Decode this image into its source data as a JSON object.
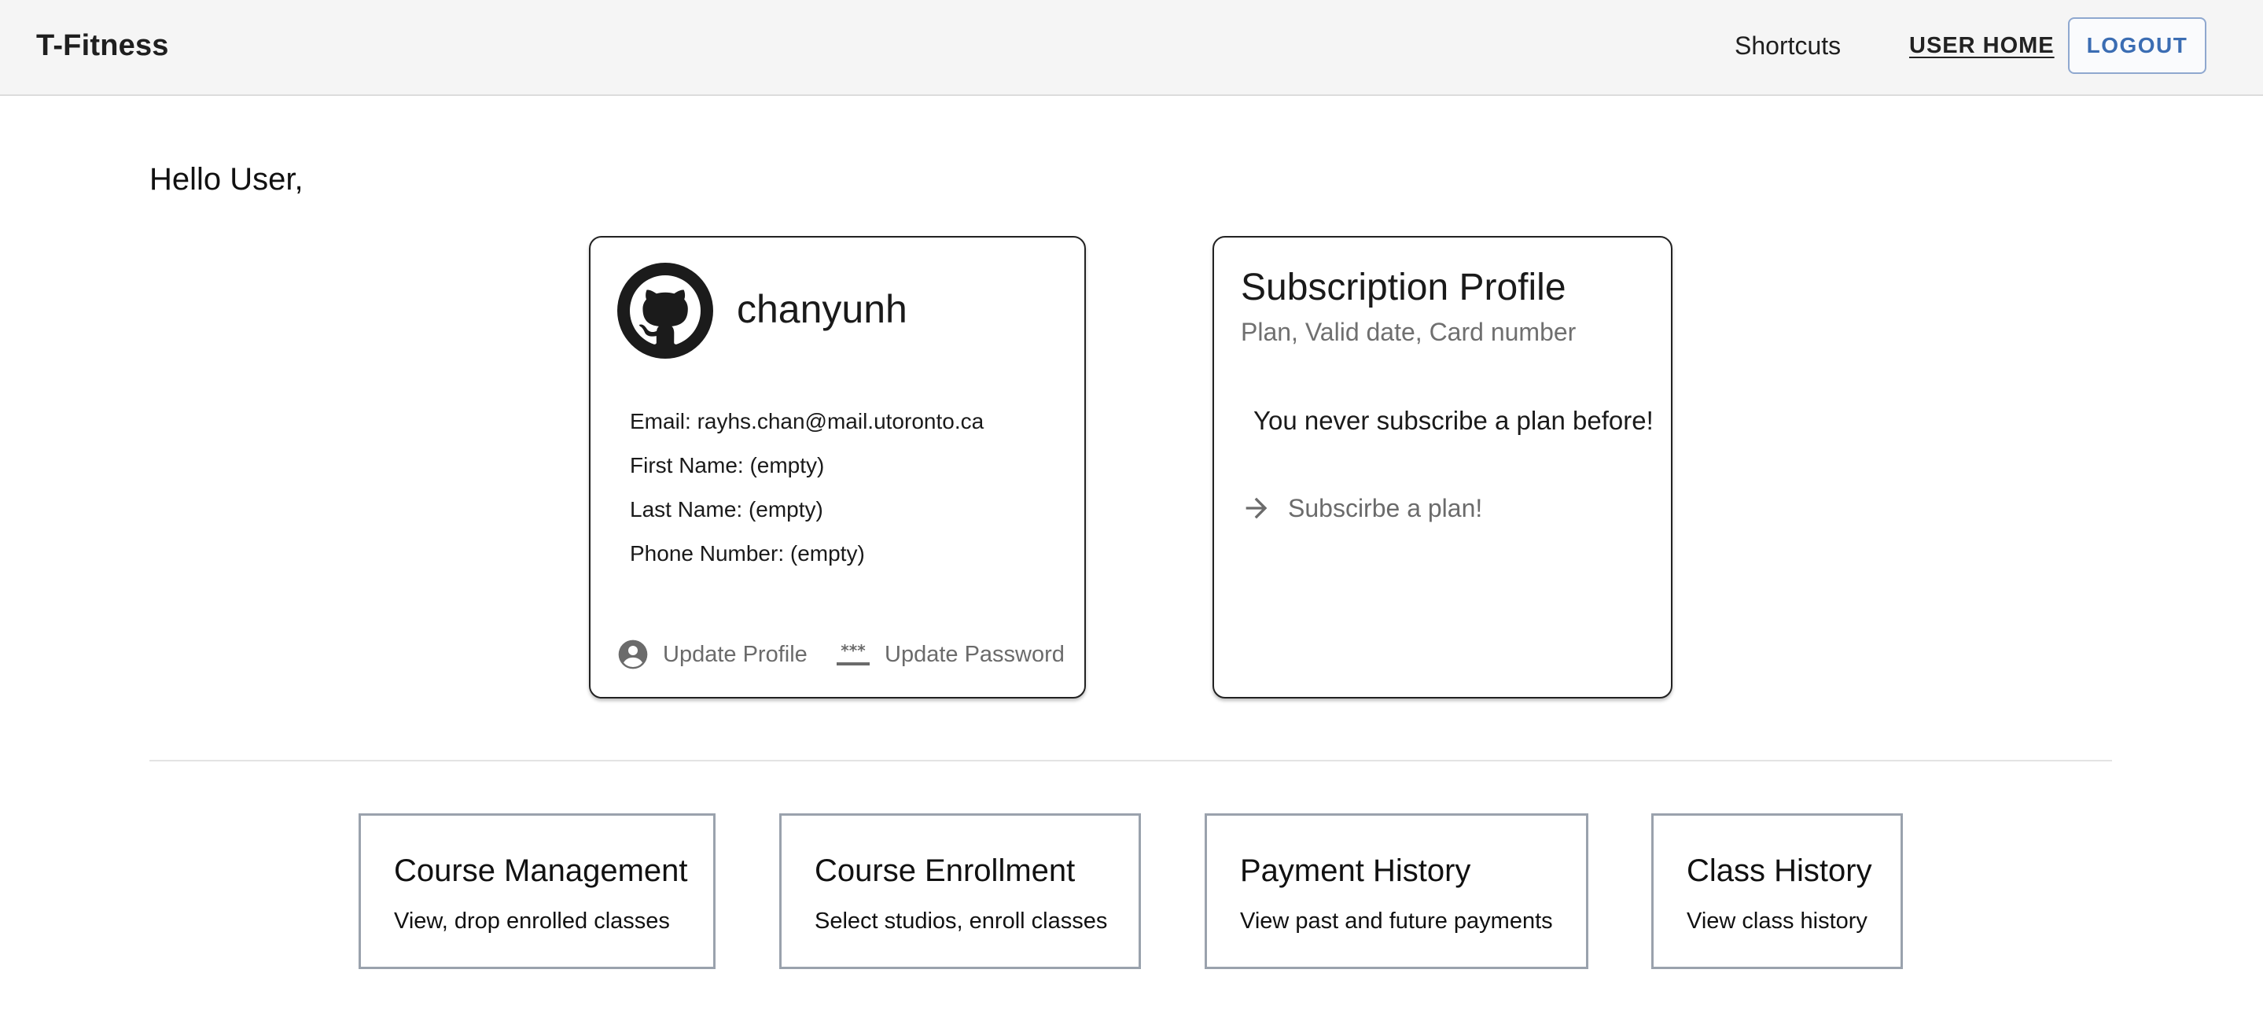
{
  "app": {
    "brand": "T-Fitness"
  },
  "nav": {
    "shortcuts": "Shortcuts",
    "user_home": "USER HOME",
    "logout": "LOGOUT"
  },
  "greeting": "Hello User,",
  "profile": {
    "avatar_icon": "github-icon",
    "username": "chanyunh",
    "email": "Email: rayhs.chan@mail.utoronto.ca",
    "first_name": "First Name: (empty)",
    "last_name": "Last Name: (empty)",
    "phone": "Phone Number: (empty)",
    "update_profile": "Update Profile",
    "update_password": "Update Password"
  },
  "subscription": {
    "title": "Subscription Profile",
    "subtitle": "Plan, Valid date, Card number",
    "message": "You never subscribe a plan before!",
    "link": "Subscirbe a plan!"
  },
  "tiles": [
    {
      "title": "Course Management",
      "description": "View, drop enrolled classes"
    },
    {
      "title": "Course Enrollment",
      "description": "Select studios, enroll classes"
    },
    {
      "title": "Payment History",
      "description": "View past and future payments"
    },
    {
      "title": "Class History",
      "description": "View class history"
    }
  ],
  "colors": {
    "appbar_bg": "#f5f5f5",
    "logout_accent": "#3b6db3",
    "tile_border": "#9aa2ad",
    "secondary_text": "#6b6b6b"
  }
}
